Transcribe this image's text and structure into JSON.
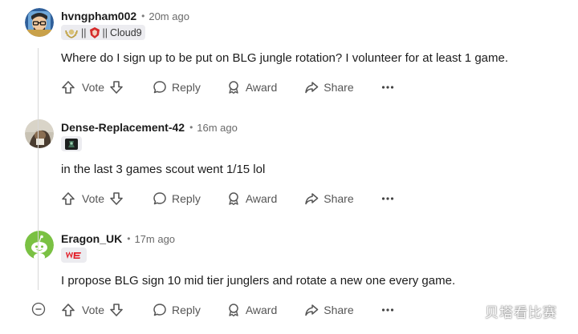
{
  "comments": [
    {
      "username": "hvngpham002",
      "separator": "•",
      "time": "20m ago",
      "avatar_icon": "cartoon-man-avatar-icon",
      "flair": {
        "icons": [
          "laurel-badge-icon",
          "lol-team-logo-icon"
        ],
        "divider": "||",
        "text": "Cloud9"
      },
      "body": "Where do I sign up to be put on BLG jungle rotation? I volunteer for at least 1 game."
    },
    {
      "username": "Dense-Replacement-42",
      "separator": "•",
      "time": "16m ago",
      "avatar_icon": "photo-avatar-icon",
      "flair": {
        "icons": [
          "dark-emblem-icon"
        ]
      },
      "body": "in the last 3 games scout went 1/15 lol"
    },
    {
      "username": "Eragon_UK",
      "separator": "•",
      "time": "17m ago",
      "avatar_icon": "reddit-snoo-green-avatar-icon",
      "flair": {
        "icons": [
          "we-team-logo-icon"
        ]
      },
      "body": "I propose BLG sign 10 mid tier junglers and rotate a new one every game."
    }
  ],
  "actions": {
    "vote": "Vote",
    "reply": "Reply",
    "award": "Award",
    "share": "Share",
    "more_icon": "ellipsis-icon"
  },
  "watermark": "贝塔看比赛",
  "colors": {
    "text": "#1c1c1c",
    "muted": "#6a6a6a",
    "action": "#555555",
    "flair_bg": "#ececf0",
    "snoo_green": "#7ac143",
    "avatar1_bg": "#2f5f9a",
    "we_red": "#e3202a"
  }
}
